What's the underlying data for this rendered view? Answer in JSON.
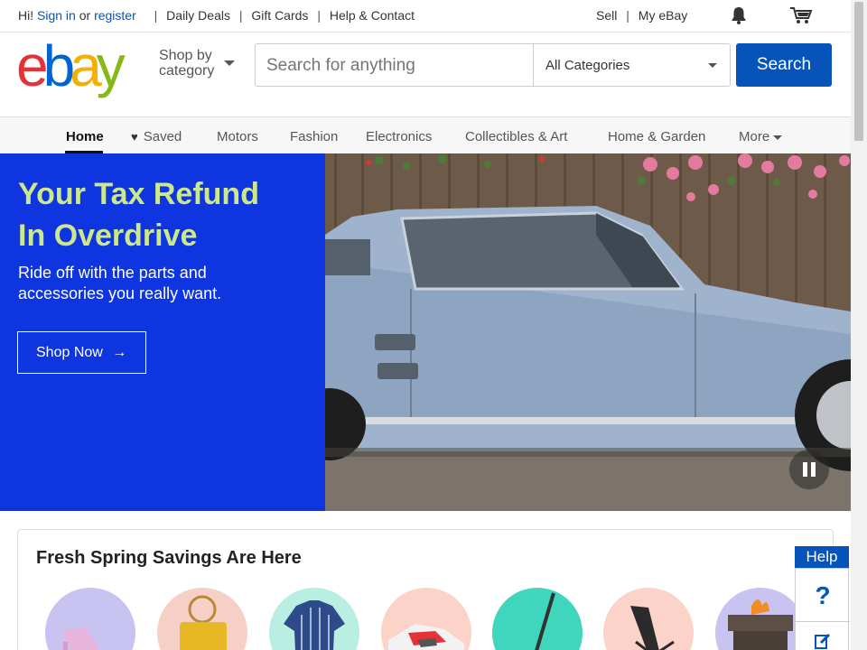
{
  "topbar": {
    "greeting": "Hi!",
    "sign_in": "Sign in",
    "or": "or",
    "register": "register",
    "links": [
      "Daily Deals",
      "Gift Cards",
      "Help & Contact"
    ],
    "sell": "Sell",
    "my_ebay": "My eBay"
  },
  "header": {
    "logo": "ebay",
    "shop_by_line1": "Shop by",
    "shop_by_line2": "category",
    "search_placeholder": "Search for anything",
    "category_select": "All Categories",
    "search_button": "Search"
  },
  "nav": {
    "items": [
      "Home",
      "Saved",
      "Motors",
      "Fashion",
      "Electronics",
      "Collectibles & Art",
      "Home & Garden",
      "More"
    ]
  },
  "hero": {
    "title_line1": "Your Tax Refund",
    "title_line2": "In Overdrive",
    "subtitle_line1": "Ride off with the parts and",
    "subtitle_line2": "accessories you really want.",
    "cta": "Shop Now",
    "cta_arrow": "→"
  },
  "promo": {
    "title": "Fresh Spring Savings Are Here"
  },
  "help": {
    "label": "Help",
    "icon": "?"
  },
  "colors": {
    "brand_blue": "#0654ba",
    "hero_blue": "#0f35e0",
    "hero_title": "#cde88a"
  }
}
